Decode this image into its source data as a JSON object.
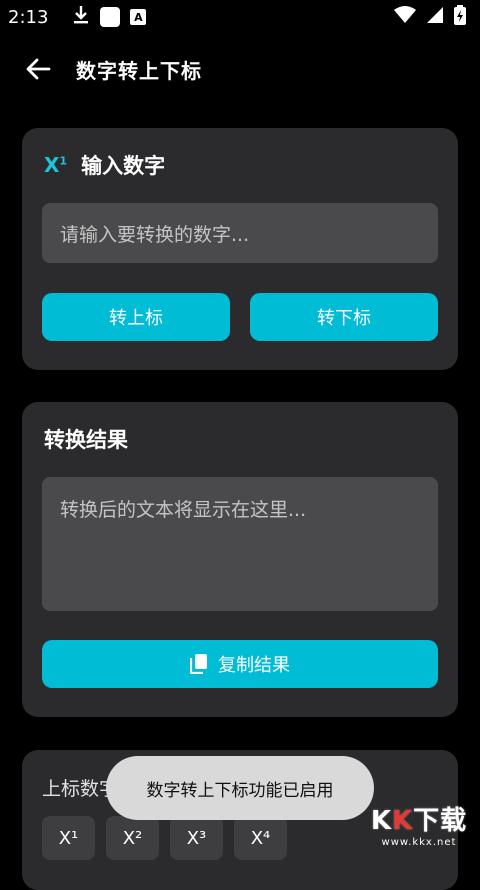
{
  "status": {
    "time": "2:13",
    "a_badge": "A"
  },
  "appbar": {
    "title": "数字转上下标"
  },
  "input_card": {
    "title": "输入数字",
    "placeholder": "请输入要转换的数字...",
    "sup_button": "转上标",
    "sub_button": "转下标"
  },
  "result_card": {
    "title": "转换结果",
    "placeholder": "转换后的文本将显示在这里...",
    "copy_button": "复制结果"
  },
  "sup_card": {
    "title": "上标数字示",
    "chips": [
      "X¹",
      "X²",
      "X³",
      "X⁴"
    ]
  },
  "toast": {
    "text": "数字转上下标功能已启用"
  },
  "watermark": {
    "logo_k1": "K",
    "logo_k2": "K",
    "logo_rest": "下载",
    "url": "www.kkx.net"
  },
  "colors": {
    "accent": "#00bcd4",
    "card_bg": "#2b2b2e",
    "field_bg": "#4a4a4d"
  }
}
